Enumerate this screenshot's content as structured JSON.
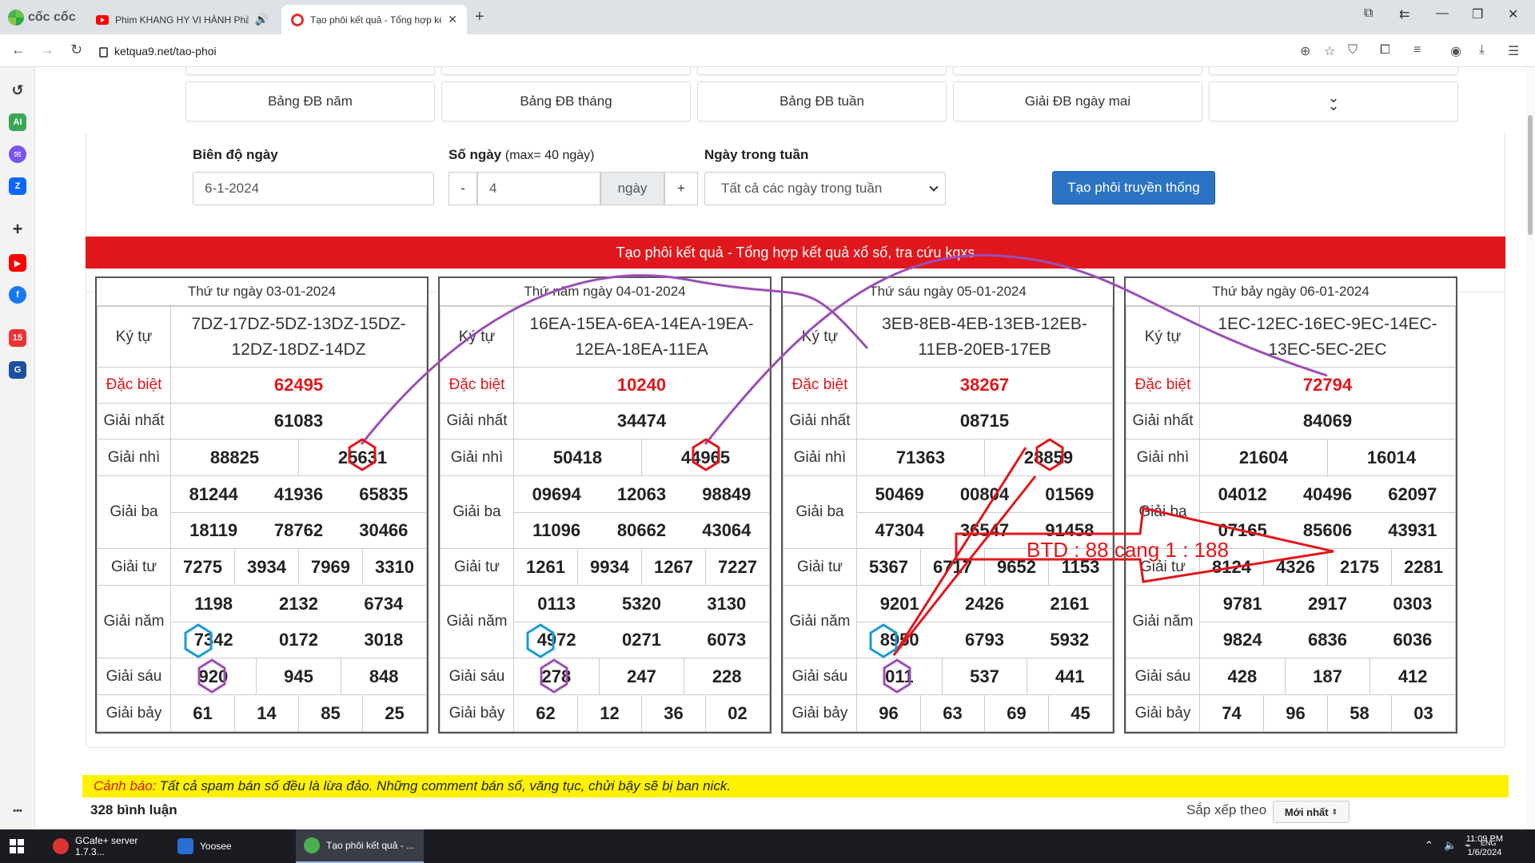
{
  "browser": {
    "brand": "cốc cốc",
    "tabs": [
      {
        "title": "Phim KHANG HY VI HÀNH Phần"
      },
      {
        "title": "Tạo phôi kết quả - Tổng hợp kế"
      }
    ],
    "url": "ketqua9.net/tao-phoi"
  },
  "nav_buttons": [
    "Bảng ĐB năm",
    "Bảng ĐB tháng",
    "Bảng ĐB tuần",
    "Giải ĐB ngày mai"
  ],
  "form": {
    "range_label": "Biên độ ngày",
    "range_value": "6-1-2024",
    "days_label": "Số ngày",
    "days_hint": "(max= 40 ngày)",
    "minus": "-",
    "days_value": "4",
    "days_unit": "ngày",
    "plus": "+",
    "weekday_label": "Ngày trong tuần",
    "weekday_value": "Tất cả các ngày trong tuần",
    "submit": "Tạo phôi truyền thống"
  },
  "banner": "Tạo phôi kết quả - Tổng hợp kết quả xổ số, tra cứu kqxs",
  "labels": {
    "kytu": "Ký tự",
    "db": "Đặc biệt",
    "g1": "Giải nhất",
    "g2": "Giải nhì",
    "g3": "Giải ba",
    "g4": "Giải tư",
    "g5": "Giải năm",
    "g6": "Giải sáu",
    "g7": "Giải bảy"
  },
  "cards": [
    {
      "date": "Thứ tư ngày 03-01-2024",
      "kytu": "7DZ-17DZ-5DZ-13DZ-15DZ-12DZ-18DZ-14DZ",
      "db": "62495",
      "g1": "61083",
      "g2": [
        "88825",
        "25631"
      ],
      "g3": [
        "81244",
        "41936",
        "65835",
        "18119",
        "78762",
        "30466"
      ],
      "g4": [
        "7275",
        "3934",
        "7969",
        "3310"
      ],
      "g5": [
        "1198",
        "2132",
        "6734",
        "7342",
        "0172",
        "3018"
      ],
      "g6": [
        "920",
        "945",
        "848"
      ],
      "g7": [
        "61",
        "14",
        "85",
        "25"
      ]
    },
    {
      "date": "Thứ năm ngày 04-01-2024",
      "kytu": "16EA-15EA-6EA-14EA-19EA-12EA-18EA-11EA",
      "db": "10240",
      "g1": "34474",
      "g2": [
        "50418",
        "44965"
      ],
      "g3": [
        "09694",
        "12063",
        "98849",
        "11096",
        "80662",
        "43064"
      ],
      "g4": [
        "1261",
        "9934",
        "1267",
        "7227"
      ],
      "g5": [
        "0113",
        "5320",
        "3130",
        "4972",
        "0271",
        "6073"
      ],
      "g6": [
        "278",
        "247",
        "228"
      ],
      "g7": [
        "62",
        "12",
        "36",
        "02"
      ]
    },
    {
      "date": "Thứ sáu ngày 05-01-2024",
      "kytu": "3EB-8EB-4EB-13EB-12EB-11EB-20EB-17EB",
      "db": "38267",
      "g1": "08715",
      "g2": [
        "71363",
        "28859"
      ],
      "g3": [
        "50469",
        "00804",
        "01569",
        "47304",
        "36547",
        "91458"
      ],
      "g4": [
        "5367",
        "6717",
        "9652",
        "1153"
      ],
      "g5": [
        "9201",
        "2426",
        "2161",
        "8950",
        "6793",
        "5932"
      ],
      "g6": [
        "011",
        "537",
        "441"
      ],
      "g7": [
        "96",
        "63",
        "69",
        "45"
      ]
    },
    {
      "date": "Thứ bảy ngày 06-01-2024",
      "kytu": "1EC-12EC-16EC-9EC-14EC-13EC-5EC-2EC",
      "db": "72794",
      "g1": "84069",
      "g2": [
        "21604",
        "16014"
      ],
      "g3": [
        "04012",
        "40496",
        "62097",
        "07165",
        "85606",
        "43931"
      ],
      "g4": [
        "8124",
        "4326",
        "2175",
        "2281"
      ],
      "g5": [
        "9781",
        "2917",
        "0303",
        "9824",
        "6836",
        "6036"
      ],
      "g6": [
        "428",
        "187",
        "412"
      ],
      "g7": [
        "74",
        "96",
        "58",
        "03"
      ]
    }
  ],
  "annotation": "BTD : 88 cang 1 : 188",
  "warning": {
    "label": "Cảnh báo:",
    "text": "Tất cả spam bán số đều là lừa đảo. Những comment bán số, văng tục, chửi bậy sẽ bị ban nick."
  },
  "comments": {
    "count": "328 bình luận",
    "sort_label": "Sắp xếp theo",
    "sort_value": "Mới nhất"
  },
  "taskbar": {
    "apps": [
      "GCafe+ server 1.7.3...",
      "Yoosee",
      "Tạo phôi kết quả - ..."
    ],
    "time": "11:09 PM",
    "date": "1/6/2024"
  }
}
